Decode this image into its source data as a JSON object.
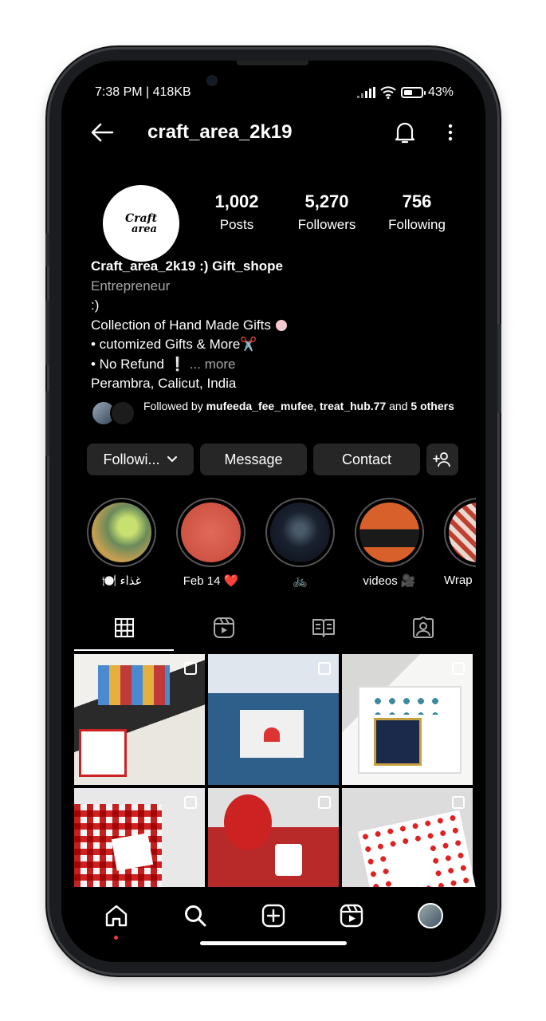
{
  "status_bar": {
    "time": "7:38 PM | 418KB",
    "battery": "43%"
  },
  "header": {
    "username": "craft_area_2k19"
  },
  "profile": {
    "avatar_logo": "Craft area",
    "stats": [
      {
        "value": "1,002",
        "label": "Posts"
      },
      {
        "value": "5,270",
        "label": "Followers"
      },
      {
        "value": "756",
        "label": "Following"
      }
    ]
  },
  "bio": {
    "name": "Craft_area_2k19 :) Gift_shope",
    "category": "Entrepreneur",
    "line1": ":)",
    "line2": "Collection of Hand Made Gifts",
    "line3": "• cutomized Gifts & More✂️",
    "line4": "• No Refund",
    "more": "... more",
    "location": "Perambra, Calicut, India"
  },
  "followed_by": {
    "prefix": "Followed by ",
    "user1": "mufeeda_fee_mufee",
    "sep": ", ",
    "user2": "treat_hub.77",
    "and": " and ",
    "others": "5 others"
  },
  "actions": {
    "following": "Followi...",
    "message": "Message",
    "contact": "Contact"
  },
  "highlights": [
    {
      "label": "🍽️ غذاء",
      "color": "#6a8a5a"
    },
    {
      "label": "Feb 14 ❤️",
      "color": "#d05a4a"
    },
    {
      "label": "🚲",
      "color": "#1a2230"
    },
    {
      "label": "videos 🎥",
      "color": "#d8602a"
    },
    {
      "label": "Wrap",
      "color": "#c04030"
    }
  ],
  "tabs": [
    "grid-tab",
    "reels-tab",
    "guides-tab",
    "tagged-tab"
  ],
  "grid_colors": [
    "#d9d6d0",
    "#3e6e96",
    "#ecebe8",
    "#c93c42",
    "#b02a2a",
    "#dcdcdc"
  ],
  "accent_notification": "#ff3040"
}
